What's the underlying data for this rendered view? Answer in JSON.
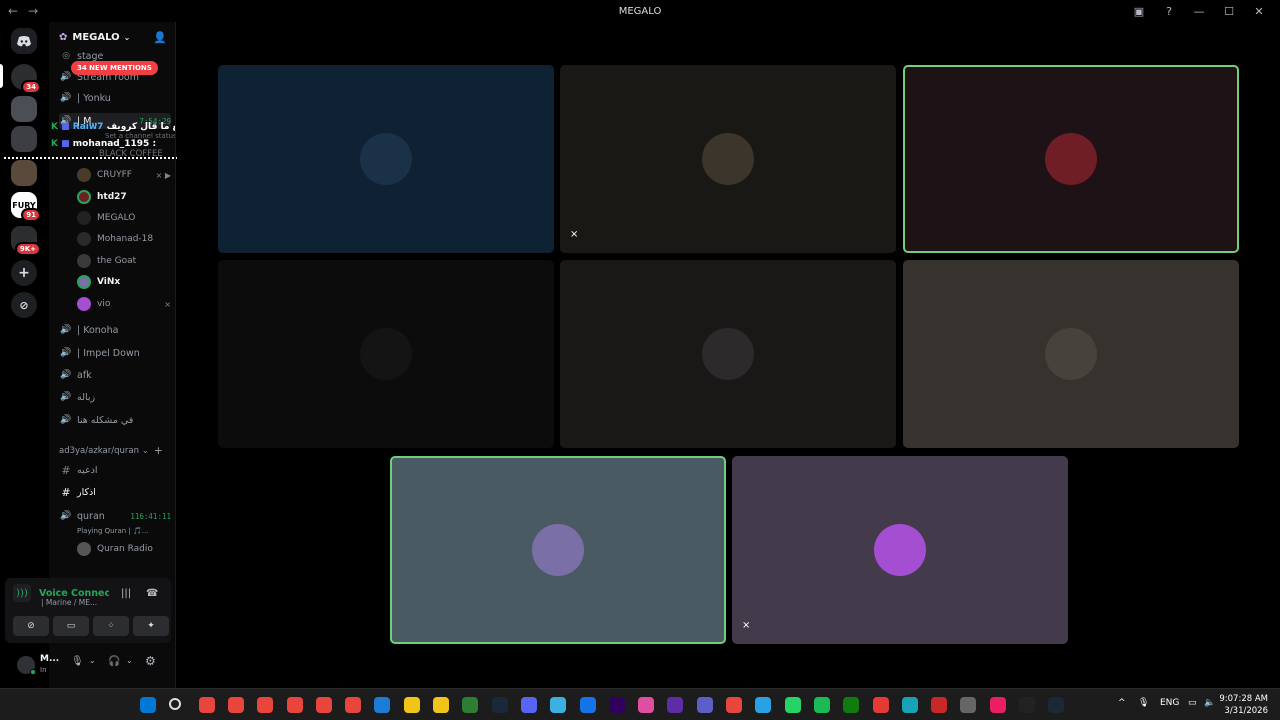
{
  "window": {
    "title": "MEGALO",
    "back": "←",
    "forward": "→",
    "controls": [
      "▣",
      "?",
      "—",
      "☐",
      "✕"
    ]
  },
  "guilds": [
    {
      "name": "discord-home",
      "label": "",
      "badge": ""
    },
    {
      "name": "server-1",
      "label": "",
      "badge": "34"
    },
    {
      "name": "server-2",
      "label": "",
      "badge": ""
    },
    {
      "name": "server-3",
      "label": "",
      "badge": ""
    },
    {
      "name": "server-4",
      "label": "",
      "badge": ""
    },
    {
      "name": "server-fury",
      "label": "FURY",
      "badge": "91"
    },
    {
      "name": "server-folder",
      "label": "",
      "badge": "9K+"
    }
  ],
  "server": {
    "name": "MEGALO",
    "mentions_label": "34 NEW MENTIONS"
  },
  "channels": [
    {
      "label": "stage",
      "icon": "stage-icon"
    },
    {
      "label": "Stream room",
      "icon": "speaker-icon"
    },
    {
      "label": "| Yonku",
      "icon": "speaker-icon"
    },
    {
      "label": "| M...",
      "icon": "speaker-icon",
      "timer": "7:54:29"
    }
  ],
  "voice_status": {
    "placeholder": "Set a channel status",
    "extra_channel": "BLACK COFFEE"
  },
  "voice_users": [
    {
      "name": "CRUYFF",
      "status": "⨯ ▶"
    },
    {
      "name": "htd27",
      "status": "",
      "bright": true
    },
    {
      "name": "MEGALO",
      "status": ""
    },
    {
      "name": "Mohanad-18",
      "status": ""
    },
    {
      "name": "the Goat",
      "status": ""
    },
    {
      "name": "ViNx",
      "status": "",
      "bright": true
    },
    {
      "name": "vio",
      "status": "⨯"
    }
  ],
  "more_channels": [
    {
      "label": "| Konoha"
    },
    {
      "label": "| Impel Down"
    },
    {
      "label": "afk"
    },
    {
      "label": "زباله"
    },
    {
      "label": "في مشكله هنا"
    }
  ],
  "category": {
    "label": "ad3ya/azkar/quran",
    "text_channels": [
      "ادعيه",
      "اذكار"
    ],
    "quran": {
      "label": "quran",
      "timer": "116:41:11",
      "activity": "Playing Quran | 🎵...",
      "user": "Quran Radio"
    }
  },
  "overlay": {
    "line1_user": "Raiw7",
    "line1_text": "الحمدلله قال مبلغ ما قال كرويف :",
    "line2_user": "mohanad_1195",
    "line2_text": ":"
  },
  "voice_panel": {
    "title": "Voice Connected",
    "subtitle": "| Marine / ME..."
  },
  "user_panel": {
    "name": "M...",
    "status": "In"
  },
  "tiles": [
    {
      "name": "tile-1",
      "bg": "#0f2233",
      "avatar_bg": "#1b3148",
      "speaking": false,
      "muted": false
    },
    {
      "name": "tile-2",
      "bg": "#1a1814",
      "avatar_bg": "#3b352c",
      "speaking": false,
      "muted": true
    },
    {
      "name": "tile-3",
      "bg": "#1f1216",
      "avatar_bg": "#6e1e24",
      "speaking": true,
      "muted": false
    },
    {
      "name": "tile-4",
      "bg": "#0c0c0c",
      "avatar_bg": "#141414",
      "speaking": false,
      "muted": false
    },
    {
      "name": "tile-5",
      "bg": "#1a1717",
      "avatar_bg": "#2c2a2a",
      "speaking": false,
      "muted": false
    },
    {
      "name": "tile-6",
      "bg": "#36332e",
      "avatar_bg": "#47423c",
      "speaking": false,
      "muted": false
    },
    {
      "name": "tile-7",
      "bg": "#4a5a63",
      "avatar_bg": "#7b6fa8",
      "speaking": true,
      "muted": false
    },
    {
      "name": "tile-8",
      "bg": "#433b4b",
      "avatar_bg": "#a44ed2",
      "speaking": false,
      "muted": true
    }
  ],
  "taskbar": {
    "lang": "ENG",
    "time": "9:07:28 AM",
    "date": "3/31/2026",
    "chevron": "^"
  },
  "colors": {
    "accent_green": "#23a55a",
    "mention_red": "#f23f43",
    "speaking_border": "#6fcf7d"
  }
}
